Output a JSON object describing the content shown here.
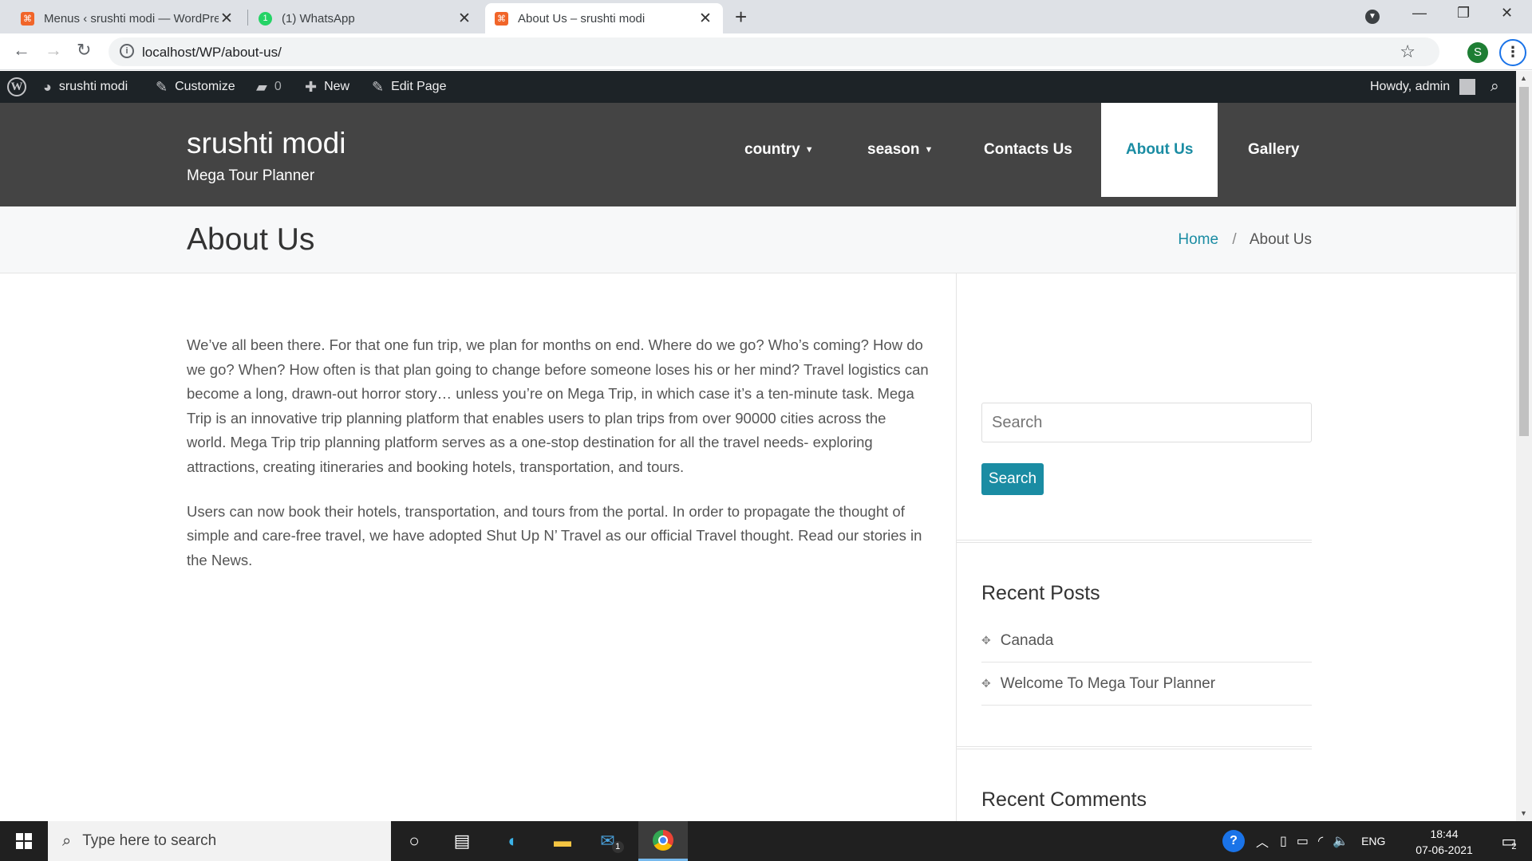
{
  "browser": {
    "tabs": [
      {
        "title": "Menus ‹ srushti modi — WordPress",
        "favicon_color": "#f16529",
        "favicon_glyph": "⌘",
        "active": false
      },
      {
        "title": "(1) WhatsApp",
        "favicon_color": "#25d366",
        "favicon_glyph": "1",
        "active": false
      },
      {
        "title": "About Us – srushti modi",
        "favicon_color": "#f16529",
        "favicon_glyph": "⌘",
        "active": true
      }
    ],
    "url": "localhost/WP/about-us/",
    "profile_initial": "S"
  },
  "admin_bar": {
    "site_name": "srushti modi",
    "customize": "Customize",
    "comments_count": "0",
    "new_label": "New",
    "edit_page": "Edit Page",
    "howdy": "Howdy, admin"
  },
  "site": {
    "title": "srushti modi",
    "tagline": "Mega Tour Planner",
    "menu": [
      {
        "label": "country",
        "dropdown": true
      },
      {
        "label": "season",
        "dropdown": true
      },
      {
        "label": "Contacts Us",
        "dropdown": false
      },
      {
        "label": "About Us",
        "dropdown": false,
        "current": true
      },
      {
        "label": "Gallery",
        "dropdown": false
      }
    ],
    "accent_color": "#1a8ca3"
  },
  "page": {
    "title": "About Us",
    "breadcrumb": {
      "home": "Home",
      "separator": "/",
      "current": "About Us"
    },
    "paragraphs": [
      "We’ve all been there. For that one fun trip, we plan for months on end. Where do we go? Who’s coming? How do we go? When? How often is that plan going to change before someone loses his or her mind? Travel logistics can become a long, drawn-out horror story… unless you’re on Mega Trip, in which case it’s a ten-minute task. Mega Trip is an innovative trip planning platform that enables users to plan trips from over 90000 cities across the world. Mega Trip trip planning platform serves as a one-stop destination for all the travel needs- exploring attractions, creating itineraries and booking hotels, transportation, and tours.",
      "Users can now book their hotels, transportation, and tours from the portal. In order to propagate the thought of simple and care-free travel, we have adopted Shut Up N’ Travel as our official Travel thought. Read our stories in the News."
    ]
  },
  "sidebar": {
    "search_placeholder": "Search",
    "search_button": "Search",
    "recent_posts_title": "Recent Posts",
    "recent_posts": [
      "Canada",
      "Welcome To Mega Tour Planner"
    ],
    "recent_comments_title": "Recent Comments"
  },
  "taskbar": {
    "search_placeholder": "Type here to search",
    "mail_badge": "1",
    "language": "ENG",
    "time": "18:44",
    "date": "07-06-2021",
    "notifications": "2"
  }
}
